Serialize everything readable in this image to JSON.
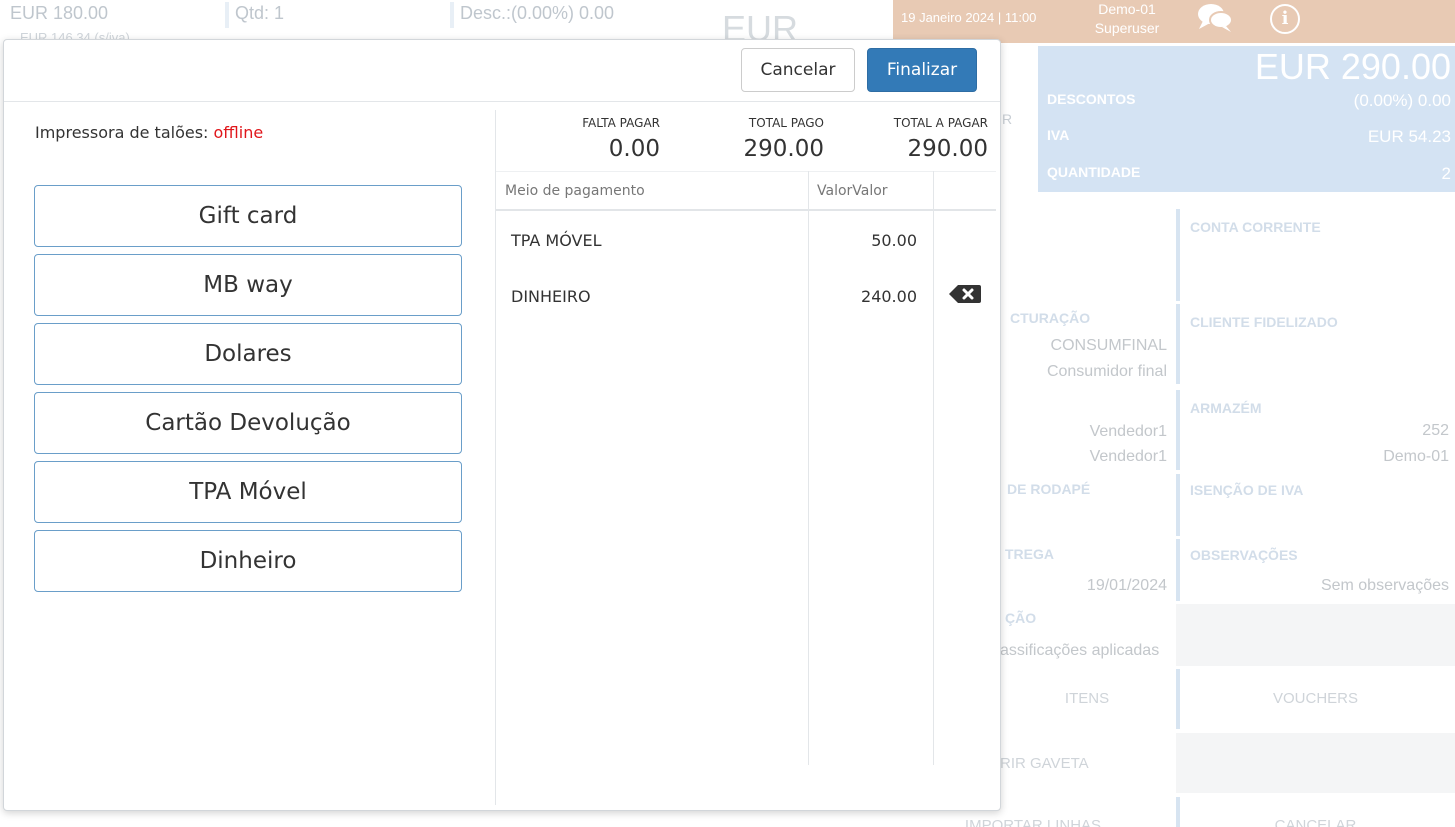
{
  "background": {
    "price": "EUR 180.00",
    "qty": "Qtd: 1",
    "discount": "Desc.:(0.00%) 0.00",
    "sub": "EUR 146.34 (s/iva)",
    "big_currency": "EUR",
    "topbar": {
      "datetime": "19 Janeiro 2024 | 11:00",
      "store": "Demo-01",
      "user": "Superuser",
      "icons": [
        "chat-icon",
        "info-icon"
      ]
    },
    "totals": {
      "total": "EUR 290.00",
      "discount_label": "DESCONTOS",
      "discount_value": "(0.00%) 0.00",
      "vat_label": "IVA",
      "vat_value": "EUR 54.23",
      "qty_label": "QUANTIDADE",
      "qty_value": "2",
      "side_letter": "R"
    },
    "tiles": {
      "current_account": "CONTA CORRENTE",
      "billing_title": "CTURAÇÃO",
      "billing_code": "CONSUMFINAL",
      "billing_name": "Consumidor final",
      "loyalty": "CLIENTE FIDELIZADO",
      "seller_1": "Vendedor1",
      "seller_2": "Vendedor1",
      "warehouse": "ARMAZÉM",
      "warehouse_code": "252",
      "warehouse_name": "Demo-01",
      "footer_title": "DE RODAPÉ",
      "vat_exemption": "ISENÇÃO DE IVA",
      "delivery_title": "TREGA",
      "delivery_date": "19/01/2024",
      "notes_title": "OBSERVAÇÕES",
      "notes_value": "Sem observações",
      "class_title": "ÇÃO",
      "class_value": "assificações aplicadas",
      "items": "ITENS",
      "vouchers": "VOUCHERS",
      "drawer": "RIR GAVETA",
      "import_lines": "IMPORTAR LINHAS",
      "cancel": "CANCELAR"
    }
  },
  "modal": {
    "cancel_label": "Cancelar",
    "finish_label": "Finalizar",
    "printer_label": "Impressora de talões: ",
    "printer_status": "offline",
    "payment_methods": [
      "Gift card",
      "MB way",
      "Dolares",
      "Cartão Devolução",
      "TPA Móvel",
      "Dinheiro"
    ],
    "summary": {
      "missing_label": "FALTA PAGAR",
      "missing_value": "0.00",
      "paid_label": "TOTAL PAGO",
      "paid_value": "290.00",
      "to_pay_label": "TOTAL A PAGAR",
      "to_pay_value": "290.00"
    },
    "table": {
      "col_method": "Meio de pagamento",
      "col_value": "ValorValor",
      "rows": [
        {
          "method": "TPA MÓVEL",
          "value": "50.00",
          "deletable": false
        },
        {
          "method": "DINHEIRO",
          "value": "240.00",
          "deletable": true
        }
      ],
      "delete_icon": "backspace-icon"
    },
    "colors": {
      "primary": "#337ab7",
      "offline": "#e0161b",
      "button_border": "#6a9ec9"
    }
  }
}
